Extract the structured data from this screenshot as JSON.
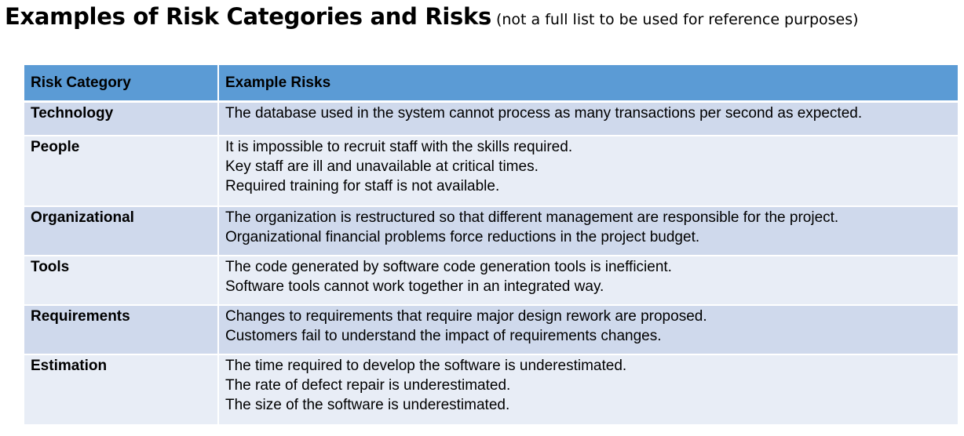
{
  "title": {
    "main": "Examples of Risk Categories and Risks",
    "subtitle": "(not a full list to be used for reference purposes)"
  },
  "table": {
    "headers": [
      "Risk Category",
      "Example Risks"
    ],
    "rows": [
      {
        "category": "Technology",
        "risks": [
          "The database used in the system cannot process as many transactions per second as expected."
        ]
      },
      {
        "category": "People",
        "risks": [
          "It is impossible to recruit staff with the skills required.",
          "Key staff are ill and unavailable at critical times.",
          "Required training for staff is not available."
        ]
      },
      {
        "category": "Organizational",
        "risks": [
          "The organization is restructured so that different management are responsible for the project.",
          "Organizational financial problems force reductions in the project budget."
        ]
      },
      {
        "category": "Tools",
        "risks": [
          "The code generated by software code generation tools is inefficient.",
          "Software tools cannot work together in an integrated way."
        ]
      },
      {
        "category": "Requirements",
        "risks": [
          "Changes to requirements that require major design rework are proposed.",
          "Customers fail to understand the impact of requirements changes."
        ]
      },
      {
        "category": "Estimation",
        "risks": [
          "The time required to develop the software is underestimated.",
          "The rate of defect repair is underestimated.",
          "The size of the software is underestimated."
        ]
      }
    ]
  },
  "colors": {
    "header_bg": "#5b9bd5",
    "row_odd_bg": "#cfd9ec",
    "row_even_bg": "#e8edf6",
    "separator": "#ffffff"
  }
}
